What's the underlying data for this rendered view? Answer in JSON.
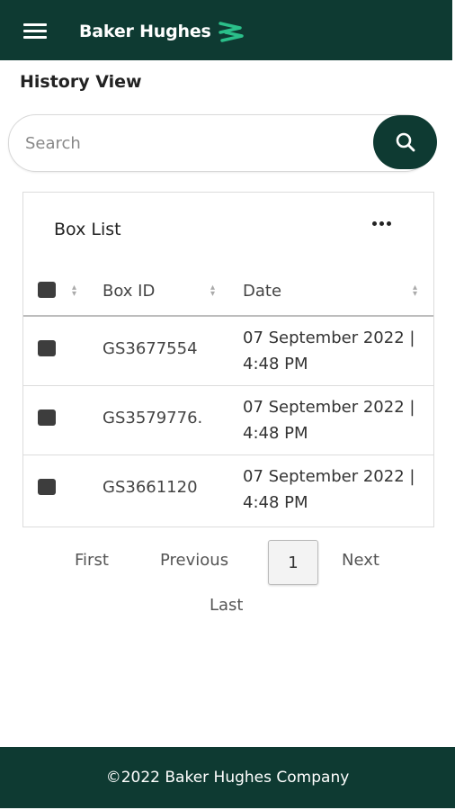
{
  "header": {
    "brand": "Baker Hughes"
  },
  "page": {
    "title": "History View"
  },
  "search": {
    "placeholder": "Search"
  },
  "card": {
    "title": "Box List",
    "columns": {
      "box_id": "Box ID",
      "date": "Date"
    },
    "rows": [
      {
        "box_id": "GS3677554",
        "date": "07 September 2022 | 4:48 PM"
      },
      {
        "box_id": "GS3579776.",
        "date": "07 September 2022 | 4:48 PM"
      },
      {
        "box_id": "GS3661120",
        "date": "07 September 2022 | 4:48 PM"
      }
    ]
  },
  "pagination": {
    "first": "First",
    "previous": "Previous",
    "current_page": "1",
    "next": "Next",
    "last": "Last"
  },
  "footer": {
    "text": "©2022 Baker Hughes Company"
  },
  "colors": {
    "brand_dark": "#0e3a32",
    "brand_accent": "#2bbf8a"
  },
  "icons": {
    "menu": "hamburger-menu-icon",
    "logo": "baker-hughes-logo-icon",
    "search": "search-icon",
    "more": "more-horizontal-icon"
  }
}
